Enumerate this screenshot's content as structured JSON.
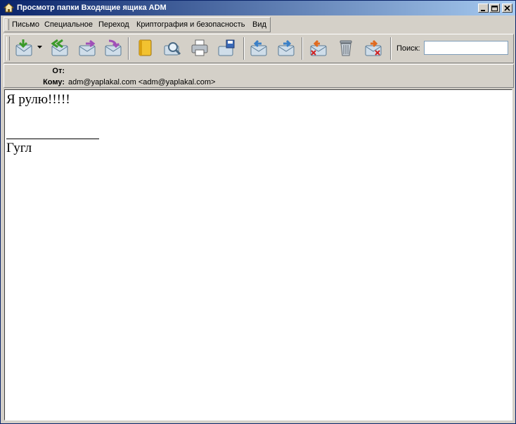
{
  "window": {
    "title": "Просмотр папки Входящие ящика ADM",
    "controls": [
      "minimize",
      "maximize",
      "close"
    ]
  },
  "menu": {
    "items": [
      {
        "label": "Письмо"
      },
      {
        "label": "Специальное"
      },
      {
        "label": "Переход"
      },
      {
        "label": "Криптография и безопасность"
      },
      {
        "label": "Вид"
      }
    ]
  },
  "toolbar": {
    "buttons": [
      {
        "icon": "receive-mail-icon"
      },
      {
        "icon": "reply-all-icon"
      },
      {
        "icon": "forward-icon"
      },
      {
        "icon": "redirect-icon"
      },
      {
        "icon": "address-book-icon"
      },
      {
        "icon": "find-icon"
      },
      {
        "icon": "print-icon"
      },
      {
        "icon": "save-icon"
      },
      {
        "icon": "previous-message-icon"
      },
      {
        "icon": "next-message-icon"
      },
      {
        "icon": "delete-message-icon"
      },
      {
        "icon": "trash-icon"
      },
      {
        "icon": "delete-move-icon"
      }
    ],
    "search": {
      "label": "Поиск:",
      "value": ""
    }
  },
  "headers": {
    "from_label": "От:",
    "from_value": "",
    "to_label": "Кому:",
    "to_value": "adm@yaplakal.com <adm@yaplakal.com>"
  },
  "message": {
    "body_line1": "Я рулю!!!!!",
    "signature": "Гугл"
  },
  "colors": {
    "titlebar_start": "#0a246a",
    "titlebar_end": "#a6caf0",
    "chrome": "#d4d0c8"
  }
}
